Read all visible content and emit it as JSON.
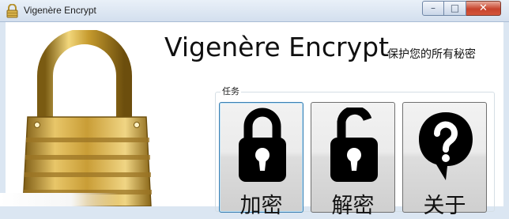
{
  "window": {
    "title": "Vigenère Encrypt",
    "controls": {
      "minimize": "–",
      "maximize": "□",
      "close": "✕"
    }
  },
  "header": {
    "app_title": "Vigenère Encrypt",
    "subtitle": "保护您的所有秘密"
  },
  "tasks": {
    "group_label": "任务",
    "buttons": [
      {
        "label": "加密",
        "icon": "locked-padlock-icon"
      },
      {
        "label": "解密",
        "icon": "unlocked-padlock-icon"
      },
      {
        "label": "关于",
        "icon": "question-bubble-icon"
      }
    ]
  },
  "colors": {
    "accent_focus": "#3c7fb1",
    "lock_gold": "#c9a341",
    "close_button": "#c7442d"
  }
}
